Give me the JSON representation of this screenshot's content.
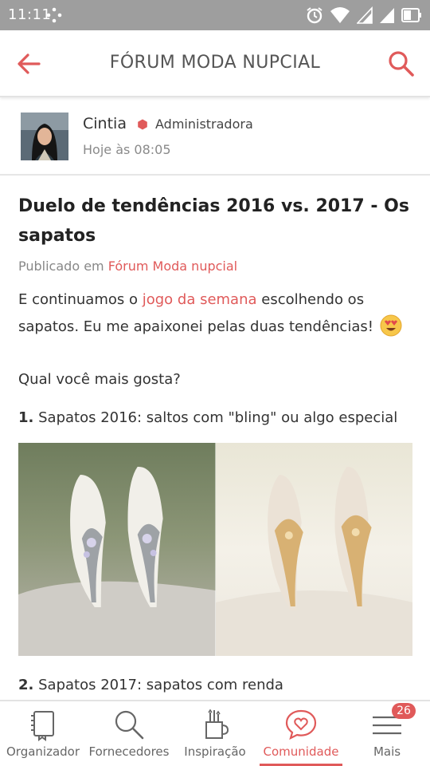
{
  "status_bar": {
    "time": "11:11"
  },
  "header": {
    "title": "FÓRUM MODA NUPCIAL"
  },
  "author": {
    "name": "Cintia",
    "role": "Administradora",
    "date": "Hoje às 08:05"
  },
  "post": {
    "title": "Duelo de tendências 2016 vs. 2017 - Os sapatos",
    "published_prefix": "Publicado em",
    "published_forum": "Fórum Moda nupcial",
    "intro_before": "E continuamos o",
    "intro_link": "jogo da semana",
    "intro_after": "escolhendo os sapatos. Eu me apaixonei pelas duas tendências!",
    "question": "Qual você mais gosta?",
    "item1_number": "1.",
    "item1_text": "Sapatos 2016: saltos com \"bling\" ou algo especial",
    "item2_number": "2.",
    "item2_text": "Sapatos 2017: sapatos com renda"
  },
  "bottom_nav": {
    "items": [
      {
        "label": "Organizador",
        "icon": "planner-icon"
      },
      {
        "label": "Fornecedores",
        "icon": "search-icon"
      },
      {
        "label": "Inspiração",
        "icon": "inspiration-icon"
      },
      {
        "label": "Comunidade",
        "icon": "heart-chat-icon",
        "active": true
      },
      {
        "label": "Mais",
        "icon": "menu-icon"
      }
    ],
    "badge_count": "26"
  },
  "colors": {
    "accent": "#e05a5a",
    "status_bar": "#9e9e9e",
    "text": "#333333"
  }
}
